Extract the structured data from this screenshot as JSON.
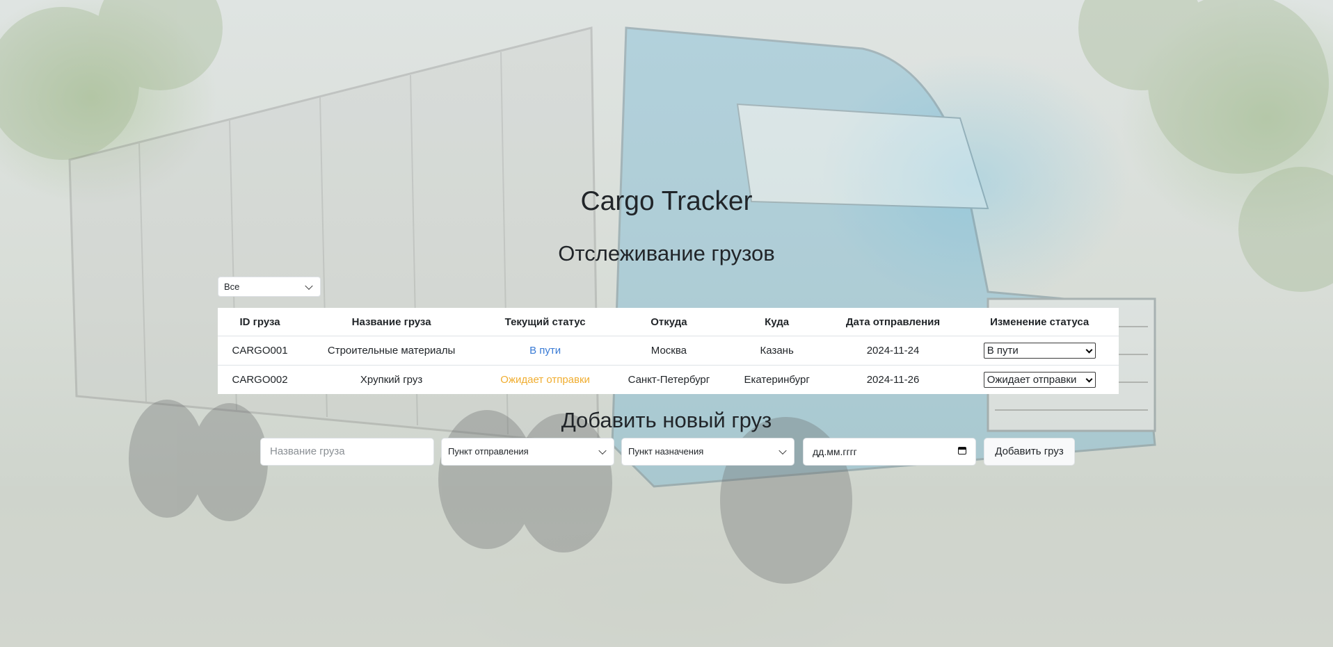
{
  "app": {
    "title": "Cargo Tracker"
  },
  "tracking": {
    "heading": "Отслеживание грузов",
    "filter": {
      "selected": "Все"
    },
    "columns": [
      "ID груза",
      "Название груза",
      "Текущий статус",
      "Откуда",
      "Куда",
      "Дата отправления",
      "Изменение статуса"
    ],
    "rows": [
      {
        "id": "CARGO001",
        "name": "Строительные материалы",
        "status": "В пути",
        "from": "Москва",
        "to": "Казань",
        "date": "2024-11-24",
        "status_select": "В пути"
      },
      {
        "id": "CARGO002",
        "name": "Хрупкий груз",
        "status": "Ожидает отправки",
        "from": "Санкт-Петербург",
        "to": "Екатеринбург",
        "date": "2024-11-26",
        "status_select": "Ожидает отправки"
      }
    ]
  },
  "add_form": {
    "heading": "Добавить новый груз",
    "name_placeholder": "Название груза",
    "from_select": "Пункт отправления",
    "to_select": "Пункт назначения",
    "date_placeholder": "дд.мм.гггг",
    "submit_label": "Добавить груз"
  },
  "colors": {
    "status_in_transit": "#3a7bd5",
    "status_waiting": "#f0ad30"
  },
  "icons": {
    "dropdown": "chevron-down-icon",
    "date": "calendar-icon"
  }
}
